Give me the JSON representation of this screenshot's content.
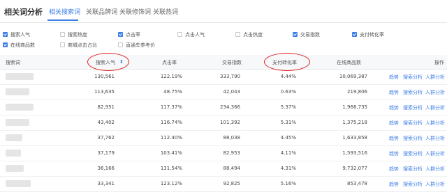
{
  "page_title": "相关词分析",
  "tabs": [
    "相关搜索词",
    "关联品牌词",
    "关联修饰词",
    "关联热词"
  ],
  "metrics": [
    {
      "label": "搜索人气",
      "checked": true
    },
    {
      "label": "搜索热度",
      "checked": false
    },
    {
      "label": "点击率",
      "checked": true
    },
    {
      "label": "点击人气",
      "checked": false
    },
    {
      "label": "点击热度",
      "checked": false
    },
    {
      "label": "交易指数",
      "checked": true
    },
    {
      "label": "支付转化率",
      "checked": true
    },
    {
      "label": "在线商品数",
      "checked": true
    },
    {
      "label": "商城点击占比",
      "checked": false
    },
    {
      "label": "直通车参考价",
      "checked": false
    }
  ],
  "table": {
    "columns": [
      "搜索词",
      "搜索人气",
      "点击率",
      "交易指数",
      "支付转化率",
      "在线商品数",
      "操作"
    ],
    "sort_icon": "sort-desc-icon",
    "actions": [
      "趋势",
      "搜索分析",
      "人群分析"
    ],
    "rows": [
      {
        "search": "130,561",
        "ctr": "122.19%",
        "trade": "333,790",
        "conv": "4.44%",
        "online": "10,069,387"
      },
      {
        "search": "113,635",
        "ctr": "48.75%",
        "trade": "42,043",
        "conv": "0.63%",
        "online": "219,806"
      },
      {
        "search": "82,951",
        "ctr": "117.37%",
        "trade": "234,366",
        "conv": "5.37%",
        "online": "1,966,735"
      },
      {
        "search": "43,402",
        "ctr": "116.74%",
        "trade": "101,392",
        "conv": "5.31%",
        "online": "1,375,218"
      },
      {
        "search": "37,762",
        "ctr": "112.40%",
        "trade": "88,038",
        "conv": "4.45%",
        "online": "1,633,858"
      },
      {
        "search": "37,179",
        "ctr": "103.41%",
        "trade": "82,953",
        "conv": "4.11%",
        "online": "1,593,516"
      },
      {
        "search": "36,166",
        "ctr": "131.54%",
        "trade": "88,494",
        "conv": "4.31%",
        "online": "9,732,077"
      },
      {
        "search": "33,341",
        "ctr": "123.12%",
        "trade": "92,825",
        "conv": "5.16%",
        "online": "853,478"
      }
    ]
  },
  "colors": {
    "accent": "#3e7fe6",
    "highlight_ring": "#e02020"
  }
}
